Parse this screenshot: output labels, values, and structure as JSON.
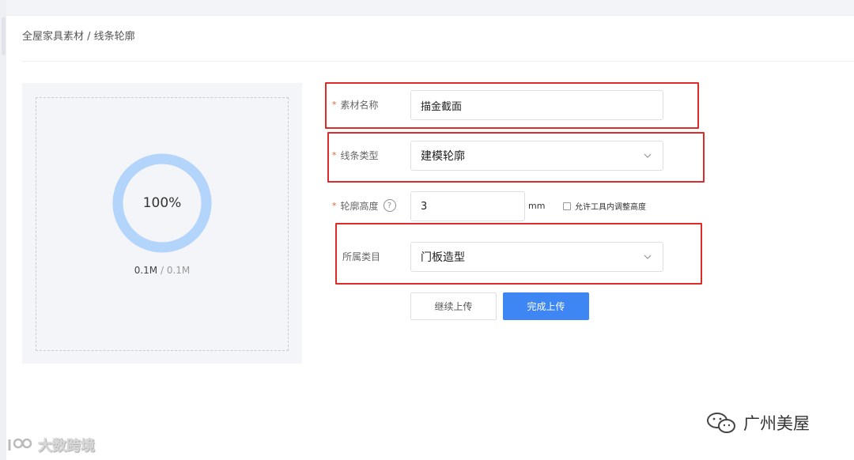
{
  "breadcrumb": {
    "text": "全屋家具素材 / 线条轮廓"
  },
  "upload": {
    "progress_percent": 100,
    "progress_label": "100%",
    "uploaded_size": "0.1M",
    "separator": "/",
    "total_size": "0.1M",
    "ring_color": "#b3d4fb"
  },
  "form": {
    "material_name": {
      "required_mark": "*",
      "label": "素材名称",
      "value": "描金截面"
    },
    "line_type": {
      "required_mark": "*",
      "label": "线条类型",
      "value": "建模轮廓",
      "icon": "chevron-down-icon"
    },
    "profile_height": {
      "required_mark": "*",
      "label": "轮廓高度",
      "help_icon": "question-circle-icon",
      "help_glyph": "?",
      "value": "3",
      "unit": "mm",
      "checkbox_label": "允许工具内调整高度",
      "checkbox_checked": false
    },
    "category": {
      "label": "所属类目",
      "value": "门板造型",
      "icon": "chevron-down-icon"
    }
  },
  "buttons": {
    "continue_label": "继续上传",
    "finish_label": "完成上传",
    "primary_color": "#3d86f4"
  },
  "highlight_color": "#dd2a2a",
  "watermarks": {
    "left_text": "大数跨境",
    "right_text": "广州美屋"
  }
}
